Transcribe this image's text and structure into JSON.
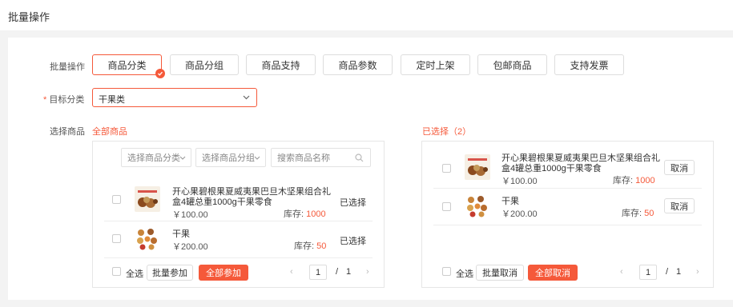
{
  "page": {
    "title": "批量操作"
  },
  "colors": {
    "accent": "#f5593a",
    "border": "#e6e6e6"
  },
  "batch_ops": {
    "label": "批量操作",
    "buttons": [
      "商品分类",
      "商品分组",
      "商品支持",
      "商品参数",
      "定时上架",
      "包邮商品",
      "支持发票"
    ],
    "active_index": 0
  },
  "target_category": {
    "required_mark": "*",
    "label": "目标分类",
    "value": "干果类"
  },
  "select_goods": {
    "label": "选择商品",
    "all_goods_label": "全部商品",
    "selected_label": "已选择（2）"
  },
  "left_panel": {
    "filters": {
      "category_placeholder": "选择商品分类",
      "group_placeholder": "选择商品分组",
      "search_placeholder": "搜索商品名称"
    },
    "products": [
      {
        "name": "开心果碧根果夏威夷果巴旦木坚果组合礼盒4罐总重1000g干果零食",
        "price": "￥100.00",
        "stock_label": "库存:",
        "stock_value": "1000",
        "status": "已选择"
      },
      {
        "name": "干果",
        "price": "￥200.00",
        "stock_label": "库存:",
        "stock_value": "50",
        "status": "已选择"
      }
    ],
    "footer": {
      "select_all": "全选",
      "batch_join": "批量参加",
      "join_all": "全部参加"
    },
    "pagination": {
      "current": "1",
      "separator": "/",
      "total": "1"
    }
  },
  "right_panel": {
    "products": [
      {
        "name": "开心果碧根果夏威夷果巴旦木坚果组合礼盒4罐总重1000g干果零食",
        "price": "￥100.00",
        "stock_label": "库存:",
        "stock_value": "1000",
        "action": "取消"
      },
      {
        "name": "干果",
        "price": "￥200.00",
        "stock_label": "库存:",
        "stock_value": "50",
        "action": "取消"
      }
    ],
    "footer": {
      "select_all": "全选",
      "batch_cancel": "批量取消",
      "cancel_all": "全部取消"
    },
    "pagination": {
      "current": "1",
      "separator": "/",
      "total": "1"
    }
  }
}
